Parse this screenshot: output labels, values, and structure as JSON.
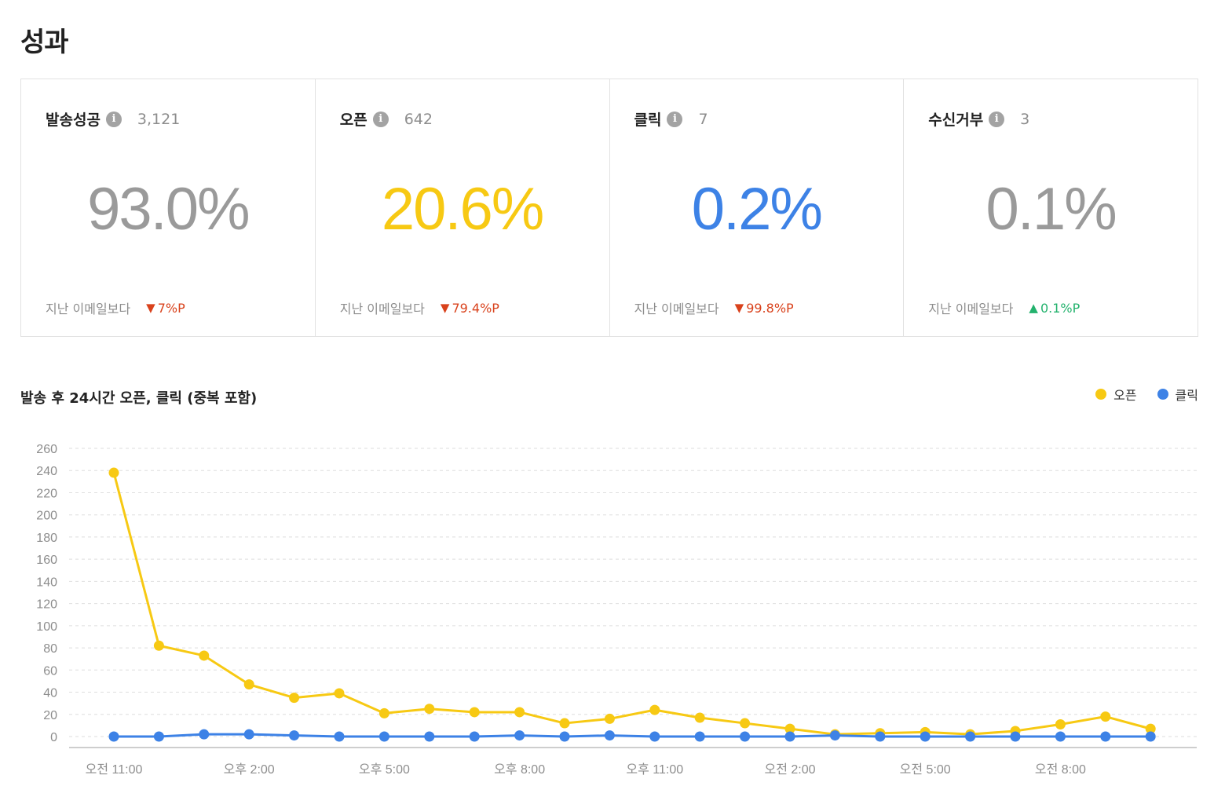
{
  "page": {
    "title": "성과"
  },
  "cards": [
    {
      "label": "발송성공",
      "count": "3,121",
      "rate": "93.0%",
      "rate_color": "#9a9a9a",
      "compare_label": "지난 이메일보다",
      "delta_arrow": "▼",
      "delta": "7%P",
      "delta_color": "#d9421c"
    },
    {
      "label": "오픈",
      "count": "642",
      "rate": "20.6%",
      "rate_color": "#f7c913",
      "compare_label": "지난 이메일보다",
      "delta_arrow": "▼",
      "delta": "79.4%P",
      "delta_color": "#d9421c"
    },
    {
      "label": "클릭",
      "count": "7",
      "rate": "0.2%",
      "rate_color": "#3d82e6",
      "compare_label": "지난 이메일보다",
      "delta_arrow": "▼",
      "delta": "99.8%P",
      "delta_color": "#d9421c"
    },
    {
      "label": "수신거부",
      "count": "3",
      "rate": "0.1%",
      "rate_color": "#9a9a9a",
      "compare_label": "지난 이메일보다",
      "delta_arrow": "▲",
      "delta": "0.1%P",
      "delta_color": "#23b26d"
    }
  ],
  "info_icon": {
    "name": "info-icon",
    "glyph": "i"
  },
  "chart_section": {
    "title": "발송 후 24시간 오픈, 클릭 (중복 포함)",
    "legend": [
      {
        "name": "오픈",
        "color": "#f7c913"
      },
      {
        "name": "클릭",
        "color": "#3d82e6"
      }
    ]
  },
  "chart_data": {
    "type": "line",
    "x_tick_labels": [
      "오전 11:00",
      "오후 2:00",
      "오후 5:00",
      "오후 8:00",
      "오후 11:00",
      "오전 2:00",
      "오전 5:00",
      "오전 8:00"
    ],
    "yticks": [
      0,
      20,
      40,
      60,
      80,
      100,
      120,
      140,
      160,
      180,
      200,
      220,
      240,
      260
    ],
    "ylim": [
      0,
      260
    ],
    "grid": true,
    "legend_position": "top-right",
    "series": [
      {
        "name": "오픈",
        "color": "#f7c913",
        "values": [
          238,
          82,
          73,
          47,
          35,
          39,
          21,
          25,
          22,
          22,
          12,
          16,
          24,
          17,
          12,
          7,
          2,
          3,
          4,
          2,
          5,
          11,
          18,
          7
        ]
      },
      {
        "name": "클릭",
        "color": "#3d82e6",
        "values": [
          0,
          0,
          2,
          2,
          1,
          0,
          0,
          0,
          0,
          1,
          0,
          1,
          0,
          0,
          0,
          0,
          1,
          0,
          0,
          0,
          0,
          0,
          0,
          0
        ]
      }
    ]
  }
}
